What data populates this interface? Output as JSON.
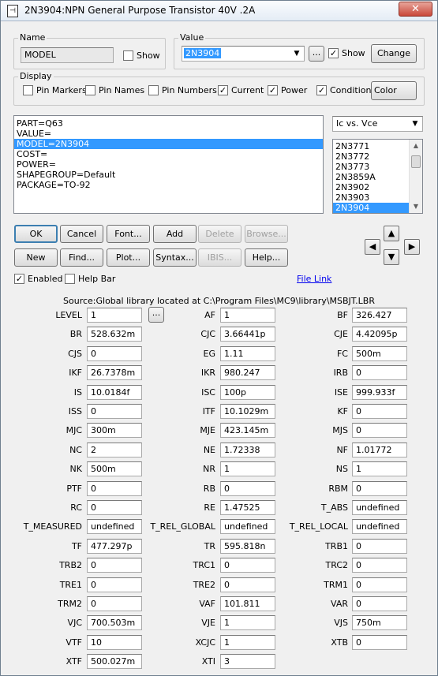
{
  "window": {
    "title": "2N3904:NPN General Purpose Transistor 40V .2A",
    "close_label": "✕"
  },
  "name_group": {
    "label": "Name",
    "value": "MODEL",
    "show_label": "Show",
    "show_checked": false
  },
  "value_group": {
    "label": "Value",
    "value": "2N3904",
    "browse_label": "...",
    "show_label": "Show",
    "show_checked": true,
    "change_label": "Change"
  },
  "display_group": {
    "label": "Display",
    "checkboxes": [
      {
        "label": "Pin Markers",
        "checked": false
      },
      {
        "label": "Pin Names",
        "checked": false
      },
      {
        "label": "Pin Numbers",
        "checked": false
      },
      {
        "label": "Current",
        "checked": true
      },
      {
        "label": "Power",
        "checked": true
      },
      {
        "label": "Condition",
        "checked": true
      }
    ],
    "color_label": "Color"
  },
  "attributes": [
    "PART=Q63",
    "VALUE=",
    "MODEL=2N3904",
    "COST=",
    "POWER=",
    "SHAPEGROUP=Default",
    "PACKAGE=TO-92"
  ],
  "attributes_selected": 2,
  "plot_select": {
    "value": "Ic vs. Vce"
  },
  "parts_list": [
    "2N3771",
    "2N3772",
    "2N3773",
    "2N3859A",
    "2N3902",
    "2N3903",
    "2N3904"
  ],
  "parts_selected": 6,
  "buttons_row1": [
    {
      "label": "OK",
      "disabled": false
    },
    {
      "label": "Cancel",
      "disabled": false
    },
    {
      "label": "Font...",
      "disabled": false
    },
    {
      "label": "Add",
      "disabled": false
    },
    {
      "label": "Delete",
      "disabled": true
    },
    {
      "label": "Browse...",
      "disabled": true
    }
  ],
  "buttons_row2": [
    {
      "label": "New",
      "disabled": false
    },
    {
      "label": "Find...",
      "disabled": false
    },
    {
      "label": "Plot...",
      "disabled": false
    },
    {
      "label": "Syntax...",
      "disabled": false
    },
    {
      "label": "IBIS...",
      "disabled": true
    },
    {
      "label": "Help...",
      "disabled": false
    }
  ],
  "enabled": {
    "label": "Enabled",
    "checked": true
  },
  "help_bar": {
    "label": "Help Bar",
    "checked": false
  },
  "file_link": "File Link",
  "source": "Source:Global library located at C:\\Program Files\\MC9\\library\\MSBJT.LBR",
  "level_browse": "...",
  "params": [
    [
      {
        "name": "LEVEL",
        "value": "1"
      },
      {
        "name": "AF",
        "value": "1"
      },
      {
        "name": "BF",
        "value": "326.427"
      }
    ],
    [
      {
        "name": "BR",
        "value": "528.632m"
      },
      {
        "name": "CJC",
        "value": "3.66441p"
      },
      {
        "name": "CJE",
        "value": "4.42095p"
      }
    ],
    [
      {
        "name": "CJS",
        "value": "0"
      },
      {
        "name": "EG",
        "value": "1.11"
      },
      {
        "name": "FC",
        "value": "500m"
      }
    ],
    [
      {
        "name": "IKF",
        "value": "26.7378m"
      },
      {
        "name": "IKR",
        "value": "980.247"
      },
      {
        "name": "IRB",
        "value": "0"
      }
    ],
    [
      {
        "name": "IS",
        "value": "10.0184f"
      },
      {
        "name": "ISC",
        "value": "100p"
      },
      {
        "name": "ISE",
        "value": "999.933f"
      }
    ],
    [
      {
        "name": "ISS",
        "value": "0"
      },
      {
        "name": "ITF",
        "value": "10.1029m"
      },
      {
        "name": "KF",
        "value": "0"
      }
    ],
    [
      {
        "name": "MJC",
        "value": "300m"
      },
      {
        "name": "MJE",
        "value": "423.145m"
      },
      {
        "name": "MJS",
        "value": "0"
      }
    ],
    [
      {
        "name": "NC",
        "value": "2"
      },
      {
        "name": "NE",
        "value": "1.72338"
      },
      {
        "name": "NF",
        "value": "1.01772"
      }
    ],
    [
      {
        "name": "NK",
        "value": "500m"
      },
      {
        "name": "NR",
        "value": "1"
      },
      {
        "name": "NS",
        "value": "1"
      }
    ],
    [
      {
        "name": "PTF",
        "value": "0"
      },
      {
        "name": "RB",
        "value": "0"
      },
      {
        "name": "RBM",
        "value": "0"
      }
    ],
    [
      {
        "name": "RC",
        "value": "0"
      },
      {
        "name": "RE",
        "value": "1.47525"
      },
      {
        "name": "T_ABS",
        "value": "undefined"
      }
    ],
    [
      {
        "name": "T_MEASURED",
        "value": "undefined"
      },
      {
        "name": "T_REL_GLOBAL",
        "value": "undefined"
      },
      {
        "name": "T_REL_LOCAL",
        "value": "undefined"
      }
    ],
    [
      {
        "name": "TF",
        "value": "477.297p"
      },
      {
        "name": "TR",
        "value": "595.818n"
      },
      {
        "name": "TRB1",
        "value": "0"
      }
    ],
    [
      {
        "name": "TRB2",
        "value": "0"
      },
      {
        "name": "TRC1",
        "value": "0"
      },
      {
        "name": "TRC2",
        "value": "0"
      }
    ],
    [
      {
        "name": "TRE1",
        "value": "0"
      },
      {
        "name": "TRE2",
        "value": "0"
      },
      {
        "name": "TRM1",
        "value": "0"
      }
    ],
    [
      {
        "name": "TRM2",
        "value": "0"
      },
      {
        "name": "VAF",
        "value": "101.811"
      },
      {
        "name": "VAR",
        "value": "0"
      }
    ],
    [
      {
        "name": "VJC",
        "value": "700.503m"
      },
      {
        "name": "VJE",
        "value": "1"
      },
      {
        "name": "VJS",
        "value": "750m"
      }
    ],
    [
      {
        "name": "VTF",
        "value": "10"
      },
      {
        "name": "XCJC",
        "value": "1"
      },
      {
        "name": "XTB",
        "value": "0"
      }
    ],
    [
      {
        "name": "XTF",
        "value": "500.027m"
      },
      {
        "name": "XTI",
        "value": "3"
      }
    ]
  ]
}
